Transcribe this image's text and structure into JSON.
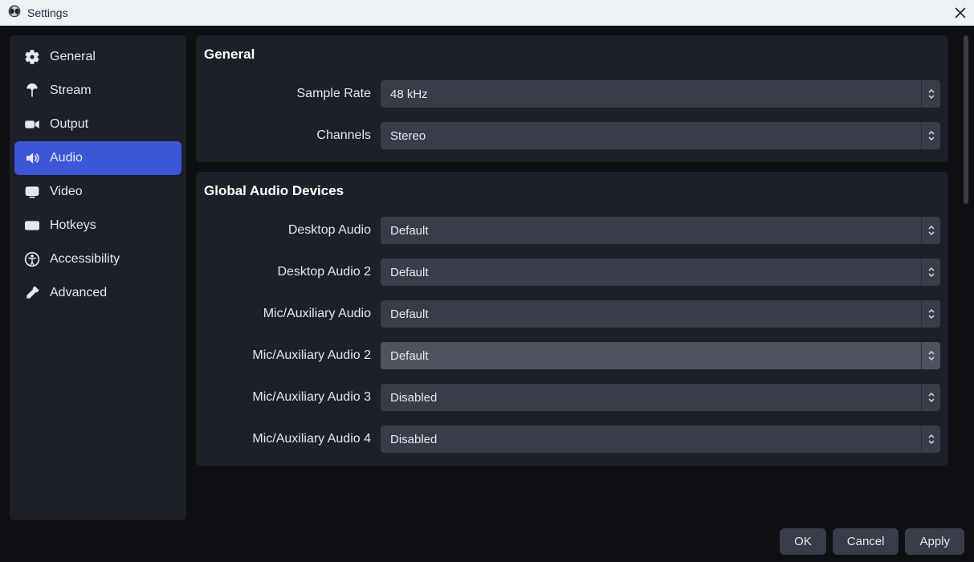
{
  "window": {
    "title": "Settings"
  },
  "sidebar": {
    "items": [
      {
        "label": "General"
      },
      {
        "label": "Stream"
      },
      {
        "label": "Output"
      },
      {
        "label": "Audio"
      },
      {
        "label": "Video"
      },
      {
        "label": "Hotkeys"
      },
      {
        "label": "Accessibility"
      },
      {
        "label": "Advanced"
      }
    ],
    "activeIndex": 3
  },
  "sections": {
    "general": {
      "title": "General",
      "sampleRate": {
        "label": "Sample Rate",
        "value": "48 kHz"
      },
      "channels": {
        "label": "Channels",
        "value": "Stereo"
      }
    },
    "globalAudio": {
      "title": "Global Audio Devices",
      "desktopAudio": {
        "label": "Desktop Audio",
        "value": "Default"
      },
      "desktopAudio2": {
        "label": "Desktop Audio 2",
        "value": "Default"
      },
      "micAux": {
        "label": "Mic/Auxiliary Audio",
        "value": "Default"
      },
      "micAux2": {
        "label": "Mic/Auxiliary Audio 2",
        "value": "Default"
      },
      "micAux3": {
        "label": "Mic/Auxiliary Audio 3",
        "value": "Disabled"
      },
      "micAux4": {
        "label": "Mic/Auxiliary Audio 4",
        "value": "Disabled"
      }
    }
  },
  "footer": {
    "ok": "OK",
    "cancel": "Cancel",
    "apply": "Apply"
  }
}
